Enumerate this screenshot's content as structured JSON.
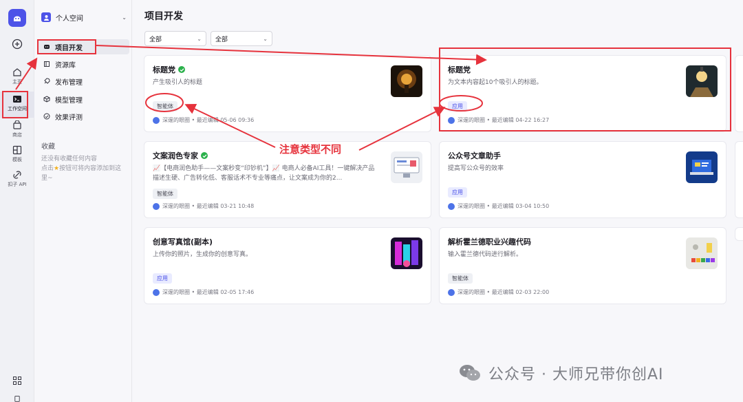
{
  "rail": {
    "items": [
      {
        "icon": "add-icon",
        "label": ""
      },
      {
        "icon": "home-icon",
        "label": "主页"
      },
      {
        "icon": "terminal-icon",
        "label": "工作空间"
      },
      {
        "icon": "store-icon",
        "label": "商店"
      },
      {
        "icon": "template-icon",
        "label": "模板"
      },
      {
        "icon": "api-icon",
        "label": "扣子 API"
      }
    ]
  },
  "sidebar": {
    "space_name": "个人空间",
    "nav": [
      {
        "label": "项目开发",
        "icon": "project-icon"
      },
      {
        "label": "资源库",
        "icon": "library-icon"
      },
      {
        "label": "发布管理",
        "icon": "rocket-icon"
      },
      {
        "label": "模型管理",
        "icon": "model-icon"
      },
      {
        "label": "效果评测",
        "icon": "evaluation-icon"
      }
    ],
    "favorites_title": "收藏",
    "favorites_empty_line1": "还没有收藏任何内容",
    "favorites_empty_line2": "点击",
    "favorites_empty_line3": "按钮可将内容添加到这里~"
  },
  "main": {
    "title": "项目开发",
    "filter1": "全部",
    "filter2": "全部"
  },
  "cards": [
    {
      "title": "标题党",
      "verified": true,
      "desc": "产生吸引人的标题",
      "tag": "智能体",
      "tag_type": "agent",
      "meta": "深邃的眼圈 • 最近编辑 05-06 09:36",
      "thumb": "lamp-dark"
    },
    {
      "title": "标题党",
      "verified": false,
      "desc": "为文本内容起10个吸引人的标题。",
      "tag": "应用",
      "tag_type": "app",
      "meta": "深邃的眼圈 • 最近编辑 04-22 16:27",
      "thumb": "lamp-bulb"
    },
    {
      "title": "文案润色专家",
      "verified": true,
      "desc": "📈【电商润色助手——文案秒变“印钞机”】📈 电商人必备AI工具！一键解决产品描述生硬、广告转化低、客服话术不专业等痛点，让文案成为你的2...",
      "tag": "智能体",
      "tag_type": "agent",
      "meta": "深邃的眼圈 • 最近编辑 03-21 10:48",
      "thumb": "monitor"
    },
    {
      "title": "公众号文章助手",
      "verified": false,
      "desc": "提高写公众号的效率",
      "tag": "应用",
      "tag_type": "app",
      "meta": "深邃的眼圈 • 最近编辑 03-04 10:50",
      "thumb": "laptop"
    },
    {
      "title": "创意写真馆(副本)",
      "verified": false,
      "desc": "上传你的照片，生成你的创意写真。",
      "tag": "应用",
      "tag_type": "app",
      "meta": "深邃的眼圈 • 最近编辑 02-05 17:46",
      "thumb": "neon"
    },
    {
      "title": "解析霍兰德职业兴趣代码",
      "verified": false,
      "desc": "输入霍兰德代码进行解析。",
      "tag": "智能体",
      "tag_type": "agent",
      "meta": "深邃的眼圈 • 最近编辑 02-03 22:00",
      "thumb": "blocks"
    }
  ],
  "annotation": {
    "note": "注意类型不同",
    "color": "#e6323c"
  },
  "watermark": "公众号 · 大师兄带你创AI",
  "colors": {
    "accent": "#4d53e8",
    "verified": "#2bb14b",
    "annotation": "#e6323c"
  }
}
